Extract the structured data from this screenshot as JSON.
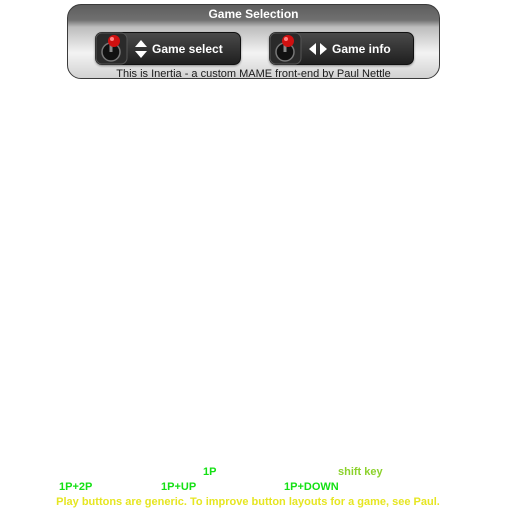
{
  "panel": {
    "title": "Game Selection",
    "caption": "This is Inertia - a custom MAME front-end by Paul Nettle",
    "buttons": [
      {
        "label": "Game select",
        "icon": "joystick-icon",
        "arrows": "up-down-arrows-icon"
      },
      {
        "label": "Game info",
        "icon": "joystick-icon",
        "arrows": "left-right-arrows-icon"
      }
    ]
  },
  "hints": {
    "p1": "1P",
    "shift": "shift key",
    "p1p2": "1P+2P",
    "p1up": "1P+UP",
    "p1down": "1P+DOWN",
    "note": "Play buttons are generic. To improve button layouts for a game, see Paul."
  },
  "colors": {
    "hint_green": "#14e014",
    "hint_lime": "#8cd22c",
    "hint_yellow": "#e6e622",
    "joystick_ball": "#d01010"
  }
}
